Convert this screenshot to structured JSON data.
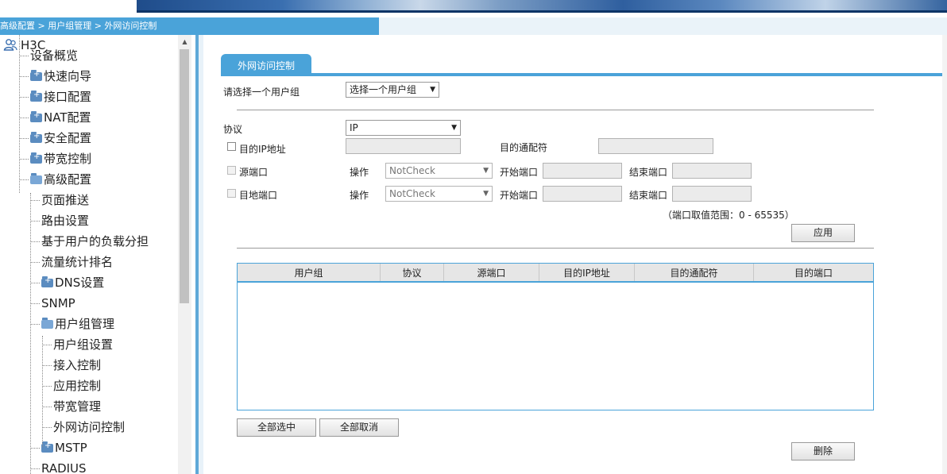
{
  "breadcrumb": "高级配置 > 用户组管理 > 外网访问控制",
  "tree": {
    "root": "H3C",
    "items": [
      {
        "label": "设备概览",
        "level": 1,
        "icon": "none"
      },
      {
        "label": "快速向导",
        "level": 1,
        "icon": "folder-closed-icon"
      },
      {
        "label": "接口配置",
        "level": 1,
        "icon": "folder-closed-icon"
      },
      {
        "label": "NAT配置",
        "level": 1,
        "icon": "folder-closed-icon"
      },
      {
        "label": "安全配置",
        "level": 1,
        "icon": "folder-closed-icon"
      },
      {
        "label": "带宽控制",
        "level": 1,
        "icon": "folder-closed-icon"
      },
      {
        "label": "高级配置",
        "level": 1,
        "icon": "folder-open-icon"
      },
      {
        "label": "页面推送",
        "level": 2,
        "icon": "none"
      },
      {
        "label": "路由设置",
        "level": 2,
        "icon": "none"
      },
      {
        "label": "基于用户的负载分担",
        "level": 2,
        "icon": "none"
      },
      {
        "label": "流量统计排名",
        "level": 2,
        "icon": "none"
      },
      {
        "label": "DNS设置",
        "level": 2,
        "icon": "folder-closed-icon"
      },
      {
        "label": "SNMP",
        "level": 2,
        "icon": "none"
      },
      {
        "label": "用户组管理",
        "level": 2,
        "icon": "folder-open-icon"
      },
      {
        "label": "用户组设置",
        "level": 3,
        "icon": "none"
      },
      {
        "label": "接入控制",
        "level": 3,
        "icon": "none"
      },
      {
        "label": "应用控制",
        "level": 3,
        "icon": "none"
      },
      {
        "label": "带宽管理",
        "level": 3,
        "icon": "none"
      },
      {
        "label": "外网访问控制",
        "level": 3,
        "icon": "none"
      },
      {
        "label": "MSTP",
        "level": 2,
        "icon": "folder-closed-icon"
      },
      {
        "label": "RADIUS",
        "level": 2,
        "icon": "none"
      }
    ]
  },
  "tab": "外网访问控制",
  "form": {
    "group_label": "请选择一个用户组",
    "group_select": "选择一个用户组",
    "protocol_label": "协议",
    "protocol_value": "IP",
    "dst_ip_label": "目的IP地址",
    "dst_wildcard_label": "目的通配符",
    "src_port_label": "源端口",
    "dst_port_label": "目地端口",
    "op_label": "操作",
    "op_value": "NotCheck",
    "start_port_label": "开始端口",
    "end_port_label": "结束端口",
    "port_range_hint": "（端口取值范围：0 - 65535）",
    "apply_button": "应用"
  },
  "table": {
    "columns": [
      "用户组",
      "协议",
      "源端口",
      "目的IP地址",
      "目的通配符",
      "目的端口"
    ],
    "rows": []
  },
  "buttons": {
    "select_all": "全部选中",
    "deselect_all": "全部取消",
    "delete": "删除"
  }
}
